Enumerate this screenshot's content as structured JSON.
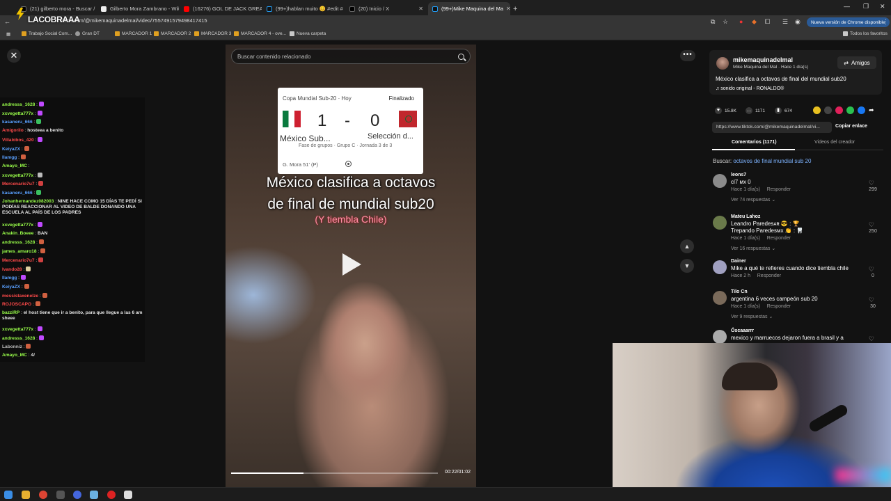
{
  "browser": {
    "tabs": [
      {
        "label": "(21) gilberto mora - Buscar / X",
        "active": false
      },
      {
        "label": "Gilberto Mora Zambrano - Wik",
        "active": false
      },
      {
        "label": "(16276) GOL DE JACK GREALIS",
        "active": false
      },
      {
        "label": "(99+)hablan muito 😊 #edit #",
        "active": false
      },
      {
        "label": "(20) Inicio / X",
        "active": false
      },
      {
        "label": "(99+)Mike Maquina del Ma",
        "active": true
      }
    ],
    "new_tab_icon": "plus-icon",
    "url": "tiktok.com/@mikemaquinadelmal/video/7557491579498417415",
    "overlay_logo": "LACOBRAAA",
    "update_button": "Nueva versión de Chrome disponible",
    "bookmarks": [
      "Trabajo Social Com...",
      "Gran DT",
      "MARCADOR 1",
      "MARCADOR 2",
      "MARCADOR 3",
      "MARCADOR 4 - ove...",
      "Nueva carpeta"
    ],
    "all_bookmarks": "Todos los favoritos"
  },
  "chat": [
    {
      "user": "andresss_1628",
      "text": "",
      "color": "#9aff4a",
      "emote": "#c04aff"
    },
    {
      "user": "xxvegetta777x",
      "text": "",
      "color": "#9aff4a",
      "emote": "#c04aff"
    },
    {
      "user": "kasaneru_666",
      "text": "",
      "color": "#5aa0ff",
      "emote": "#3ac060"
    },
    {
      "user": "Amigorilo",
      "text": "hosteea a benito",
      "color": "#ff4a4a",
      "emote": ""
    },
    {
      "user": "Villalobos_420",
      "text": "",
      "color": "#ff4a4a",
      "emote": "#c04aff"
    },
    {
      "user": "KeiyaZX",
      "text": "",
      "color": "#5aa0ff",
      "emote": "#d06040"
    },
    {
      "user": "llamgg",
      "text": "",
      "color": "#5aa0ff",
      "emote": "#d06040"
    },
    {
      "user": "Amayo_MC",
      "text": "",
      "color": "#9aff4a",
      "emote": ""
    },
    {
      "user": "xxvegetta777x",
      "text": "",
      "color": "#9aff4a",
      "emote": "#bbbbbb"
    },
    {
      "user": "Mercenario7u7",
      "text": "",
      "color": "#ff4a4a",
      "emote": "#d04040"
    },
    {
      "user": "kasaneru_666",
      "text": "",
      "color": "#5aa0ff",
      "emote": "#3ac060"
    },
    {
      "user": "Johanhernandez082003",
      "text": "NINE HACE COMO 15 DÍAS TE PEDÍ SI PODÍAS REACCIONAR AL VIDEO DE BALDE DONANDO UNA ESCUELA AL PAÍS DE LOS PADRES",
      "color": "#9aff4a",
      "emote": ""
    },
    {
      "user": "xxvegetta777x",
      "text": "",
      "color": "#9aff4a",
      "emote": "#c04aff"
    },
    {
      "user": "Anakin_Boeee",
      "text": "BAN",
      "color": "#9aff4a",
      "emote": ""
    },
    {
      "user": "andresss_1628",
      "text": "",
      "color": "#9aff4a",
      "emote": "#d06040"
    },
    {
      "user": "james_amaro18",
      "text": "",
      "color": "#9aff4a",
      "emote": "#d06040"
    },
    {
      "user": "Mercenario7u7",
      "text": "",
      "color": "#ff4a4a",
      "emote": "#d04040"
    },
    {
      "user": "Ivando28",
      "text": "",
      "color": "#ff4a4a",
      "emote": "#e0d0a0"
    },
    {
      "user": "llamgg",
      "text": "",
      "color": "#5aa0ff",
      "emote": "#c04aff"
    },
    {
      "user": "KeiyaZX",
      "text": "",
      "color": "#5aa0ff",
      "emote": "#d06040"
    },
    {
      "user": "messistaxenelze",
      "text": "",
      "color": "#ff4a4a",
      "emote": "#d06040"
    },
    {
      "user": "ROJOSCAPO",
      "text": "",
      "color": "#ff4a4a",
      "emote": "#d06040"
    },
    {
      "user": "bazziRP",
      "text": "el host tiene que ir a benito, para que llegue a las 6 am sheee",
      "color": "#9aff4a",
      "emote": ""
    },
    {
      "user": "xxvegetta777x",
      "text": "",
      "color": "#9aff4a",
      "emote": "#c04aff"
    },
    {
      "user": "andresss_1628",
      "text": "",
      "color": "#9aff4a",
      "emote": "#c04aff"
    },
    {
      "user": "Labonniz",
      "text": "",
      "color": "#bbbbbb",
      "emote": "#d06040"
    },
    {
      "user": "Amayo_MC",
      "text": "4/",
      "color": "#9aff4a",
      "emote": ""
    }
  ],
  "video": {
    "search_placeholder": "Buscar contenido relacionado",
    "score_header": "Copa Mundial Sub-20 · Hoy",
    "status": "Finalizado",
    "score_home": "1",
    "score_sep": "-",
    "score_away": "0",
    "team_home": "México Sub...",
    "team_away": "Selección d...",
    "stage": "Fase de grupos · Grupo C · Jornada 3 de 3",
    "scorer": "G. Mora 51' (P)",
    "caption_line1": "México clasifica a octavos",
    "caption_line2": "de final de mundial sub20",
    "caption_line3": "(Y tiembla Chile)",
    "time": "00:22/01:02",
    "progress": 0.35
  },
  "post": {
    "username": "mikemaquinadelmal",
    "subtitle": "Mike Maquina del Mal · Hace 1 día(s)",
    "friends_button": "Amigos",
    "description": "México clasifica a octavos de final del mundial sub20",
    "sound": "sonido original - RONALDO®",
    "likes": "15.8K",
    "comments_count": "1171",
    "saves": "674",
    "link": "https://www.tiktok.com/@mikemaquinadelmal/vi...",
    "copy_label": "Copiar enlace",
    "tab_comments": "Comentarios (1171)",
    "tab_creator": "Videos del creador",
    "search_label": "Buscar:",
    "search_query": "octavos de final mundial sub 20"
  },
  "comments": [
    {
      "name": "leons7",
      "text": "cl7 мх 0",
      "meta": "Hace 1 día(s)     Responder",
      "replies": "Ver 74 respuestas ⌄",
      "likes": "299",
      "color": "#8a8a8a"
    },
    {
      "name": "Mateu Lahoz",
      "text": "Leandro Paredesᴀʀ 😎 : 🏆\nTrepando Paredesмx 👏 : 🦷",
      "meta": "Hace 1 día(s)     Responder",
      "replies": "Ver 16 respuestas ⌄",
      "likes": "250",
      "color": "#6a7a4a"
    },
    {
      "name": "Dainer",
      "text": "Mike a qué te refieres cuando dice tiembla chile",
      "meta": "Hace 2 h     Responder",
      "replies": "",
      "likes": "0",
      "color": "#a0a0c0"
    },
    {
      "name": "Tilo Cn",
      "text": "argentina 6 veces campeón sub 20",
      "meta": "Hace 1 día(s)     Responder",
      "replies": "Ver 9 respuestas ⌄",
      "likes": "30",
      "color": "#7a6a5a"
    },
    {
      "name": "Óscaaarrr",
      "text": "mexico y marruecos dejaron fuera a brasil y a",
      "meta": "",
      "replies": "",
      "likes": "",
      "color": "#aaaaaa"
    }
  ]
}
